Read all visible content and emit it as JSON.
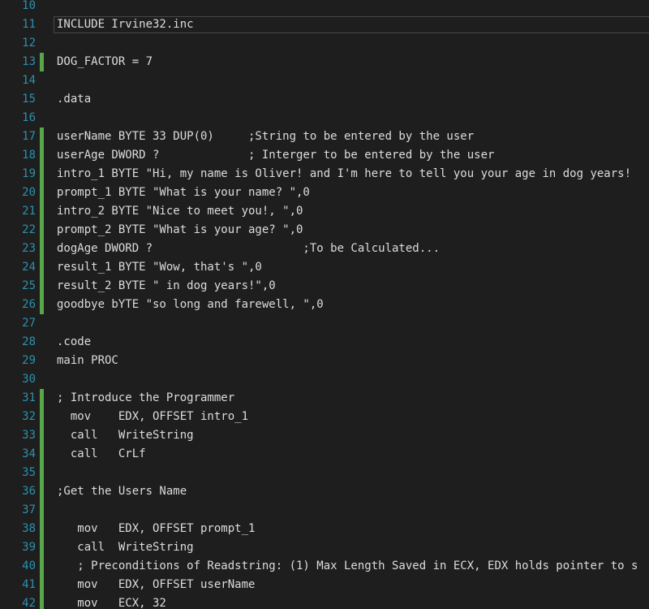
{
  "editor": {
    "lines": [
      {
        "num": "10",
        "text": "",
        "changed": false
      },
      {
        "num": "11",
        "text": "INCLUDE Irvine32.inc",
        "changed": false
      },
      {
        "num": "12",
        "text": "",
        "changed": false
      },
      {
        "num": "13",
        "text": "DOG_FACTOR = 7",
        "changed": true
      },
      {
        "num": "14",
        "text": "",
        "changed": false
      },
      {
        "num": "15",
        "text": ".data",
        "changed": false
      },
      {
        "num": "16",
        "text": "",
        "changed": false
      },
      {
        "num": "17",
        "text": "userName BYTE 33 DUP(0)     ;String to be entered by the user",
        "changed": true
      },
      {
        "num": "18",
        "text": "userAge DWORD ?             ; Interger to be entered by the user",
        "changed": true
      },
      {
        "num": "19",
        "text": "intro_1 BYTE \"Hi, my name is Oliver! and I'm here to tell you your age in dog years!",
        "changed": true
      },
      {
        "num": "20",
        "text": "prompt_1 BYTE \"What is your name? \",0",
        "changed": true
      },
      {
        "num": "21",
        "text": "intro_2 BYTE \"Nice to meet you!, \",0",
        "changed": true
      },
      {
        "num": "22",
        "text": "prompt_2 BYTE \"What is your age? \",0",
        "changed": true
      },
      {
        "num": "23",
        "text": "dogAge DWORD ?                      ;To be Calculated...",
        "changed": true
      },
      {
        "num": "24",
        "text": "result_1 BYTE \"Wow, that's \",0",
        "changed": true
      },
      {
        "num": "25",
        "text": "result_2 BYTE \" in dog years!\",0",
        "changed": true
      },
      {
        "num": "26",
        "text": "goodbye bYTE \"so long and farewell, \",0",
        "changed": true
      },
      {
        "num": "27",
        "text": "",
        "changed": false
      },
      {
        "num": "28",
        "text": ".code",
        "changed": false
      },
      {
        "num": "29",
        "text": "main PROC",
        "changed": false
      },
      {
        "num": "30",
        "text": "",
        "changed": false
      },
      {
        "num": "31",
        "text": "; Introduce the Programmer",
        "changed": true
      },
      {
        "num": "32",
        "text": "  mov    EDX, OFFSET intro_1",
        "changed": true
      },
      {
        "num": "33",
        "text": "  call   WriteString",
        "changed": true
      },
      {
        "num": "34",
        "text": "  call   CrLf",
        "changed": true
      },
      {
        "num": "35",
        "text": "",
        "changed": true
      },
      {
        "num": "36",
        "text": ";Get the Users Name",
        "changed": true
      },
      {
        "num": "37",
        "text": "",
        "changed": true
      },
      {
        "num": "38",
        "text": "   mov   EDX, OFFSET prompt_1",
        "changed": true
      },
      {
        "num": "39",
        "text": "   call  WriteString",
        "changed": true
      },
      {
        "num": "40",
        "text": "   ; Preconditions of Readstring: (1) Max Length Saved in ECX, EDX holds pointer to s",
        "changed": true
      },
      {
        "num": "41",
        "text": "   mov   EDX, OFFSET userName",
        "changed": true
      },
      {
        "num": "42",
        "text": "   mov   ECX, 32",
        "changed": true
      }
    ]
  },
  "colors": {
    "background": "#1e1e1e",
    "line_number": "#2b91af",
    "code_text": "#dcdcdc",
    "change_marker": "#57a64a",
    "current_line_border": "#464646"
  }
}
